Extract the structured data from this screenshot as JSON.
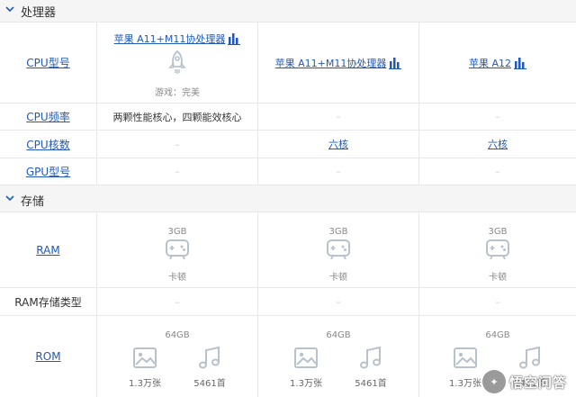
{
  "sections": {
    "processor": {
      "title": "处理器"
    },
    "storage": {
      "title": "存储"
    }
  },
  "rows": {
    "cpu_model": {
      "label": "CPU型号",
      "col1": {
        "name": "苹果 A11+M11协处理器",
        "sub": "游戏：完美"
      },
      "col2": {
        "name": "苹果 A11+M11协处理器"
      },
      "col3": {
        "name": "苹果 A12"
      }
    },
    "cpu_freq": {
      "label": "CPU频率",
      "col1": "两颗性能核心，四颗能效核心",
      "col2": "–",
      "col3": "–"
    },
    "cpu_cores": {
      "label": "CPU核数",
      "col1": "–",
      "col2": "六核",
      "col3": "六核"
    },
    "gpu_model": {
      "label": "GPU型号",
      "col1": "–",
      "col2": "–",
      "col3": "–"
    },
    "ram": {
      "label": "RAM",
      "col1": {
        "size": "3GB",
        "status": "卡顿"
      },
      "col2": {
        "size": "3GB",
        "status": "卡顿"
      },
      "col3": {
        "size": "3GB",
        "status": "卡顿"
      }
    },
    "ram_type": {
      "label": "RAM存储类型",
      "col1": "–",
      "col2": "–",
      "col3": "–"
    },
    "rom": {
      "label": "ROM",
      "col1": {
        "size": "64GB",
        "photos": "1.3万张",
        "songs": "5461首"
      },
      "col2": {
        "size": "64GB",
        "photos": "1.3万张",
        "songs": "5461首"
      },
      "col3": {
        "size": "64GB",
        "photos": "1.3万张",
        "songs": "5461首"
      }
    }
  },
  "watermark": {
    "text": "悟空问答"
  },
  "colors": {
    "link": "#2059b8",
    "border": "#e8e8e8",
    "header_bg": "#f5f5f5",
    "icon_gray": "#b8c2cc",
    "icon_blue": "#2059b8"
  }
}
